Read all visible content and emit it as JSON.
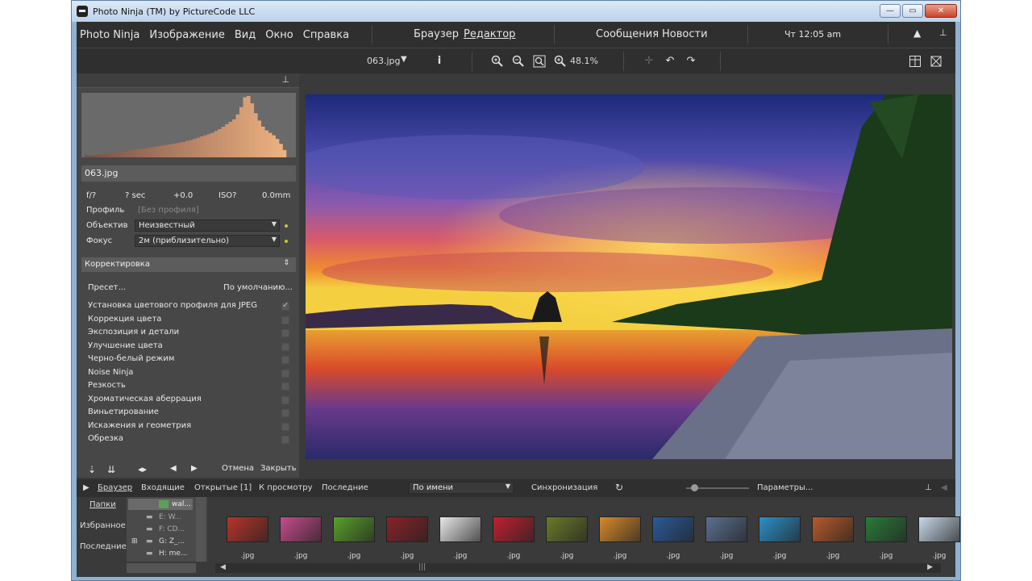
{
  "window": {
    "title": "Photo Ninja (TM) by PictureCode LLC",
    "minimize": "—",
    "maximize": "▭",
    "close": "✕"
  },
  "menu": {
    "items": [
      "Photo Ninja",
      "Изображение",
      "Вид",
      "Окно",
      "Справка"
    ],
    "modes": {
      "browser": "Браузер",
      "editor": "Редактор"
    },
    "messages": "Сообщения",
    "news": "Новости",
    "clock": "Чт 12:05 am"
  },
  "toolbar": {
    "filename": "063.jpg",
    "zoom": "48.1%"
  },
  "histogram": {
    "bars": [
      4,
      3,
      3,
      4,
      5,
      6,
      6,
      7,
      8,
      8,
      9,
      10,
      11,
      12,
      13,
      14,
      14,
      15,
      16,
      17,
      18,
      19,
      20,
      21,
      22,
      23,
      24,
      25,
      27,
      28,
      30,
      32,
      34,
      36,
      38,
      40,
      43,
      46,
      50,
      54,
      58,
      62,
      70,
      82,
      98,
      100,
      88,
      72,
      60,
      50,
      44,
      40,
      36,
      30,
      22,
      12
    ]
  },
  "left": {
    "file": "063.jpg",
    "exif": {
      "aperture": "f/?",
      "shutter": "? sec",
      "ev": "+0.0",
      "iso": "ISO?",
      "focal": "0.0mm"
    },
    "profile_label": "Профиль",
    "profile_value": "[Без профиля]",
    "lens_label": "Объектив",
    "lens_value": "Неизвестный",
    "focus_label": "Фокус",
    "focus_value": "2м (приблизительно)",
    "section": "Корректировка",
    "preset_label": "Пресет...",
    "preset_value": "По умолчанию...",
    "corrections": [
      {
        "label": "Установка цветового профиля для JPEG",
        "checked": true
      },
      {
        "label": "Коррекция цвета",
        "checked": false
      },
      {
        "label": "Экспозиция и детали",
        "checked": false
      },
      {
        "label": "Улучшение цвета",
        "checked": false
      },
      {
        "label": "Черно-белый режим",
        "checked": false
      },
      {
        "label": "Noise Ninja",
        "checked": false
      },
      {
        "label": "Резкость",
        "checked": false
      },
      {
        "label": "Хроматическая аберрация",
        "checked": false
      },
      {
        "label": "Виньетирование",
        "checked": false
      },
      {
        "label": "Искажения и геометрия",
        "checked": false
      },
      {
        "label": "Обрезка",
        "checked": false
      }
    ],
    "cancel": "Отмена",
    "close": "Закрыть"
  },
  "browser": {
    "tabs": [
      "Браузер",
      "Входящие",
      "Открытые [1]",
      "К просмотру",
      "Последние"
    ],
    "sort": "По имени",
    "sync": "Синхронизация",
    "params": "Параметры...",
    "nav": [
      "Папки",
      "Избранное",
      "Последние"
    ],
    "tree": [
      "wal...",
      "E: W...",
      "F: CD...",
      "G: Z_...",
      "H: me..."
    ],
    "thumb_caption": ".jpg",
    "thumb_colors": [
      "#b8342a",
      "#c64c8c",
      "#5aa02a",
      "#8a2228",
      "#e8e8e8",
      "#c02030",
      "#6a7a2a",
      "#d88a2a",
      "#2a5a9a",
      "#5a7090",
      "#2a90c8",
      "#b85a2a",
      "#2a7a3a",
      "#c8d8e8"
    ]
  }
}
